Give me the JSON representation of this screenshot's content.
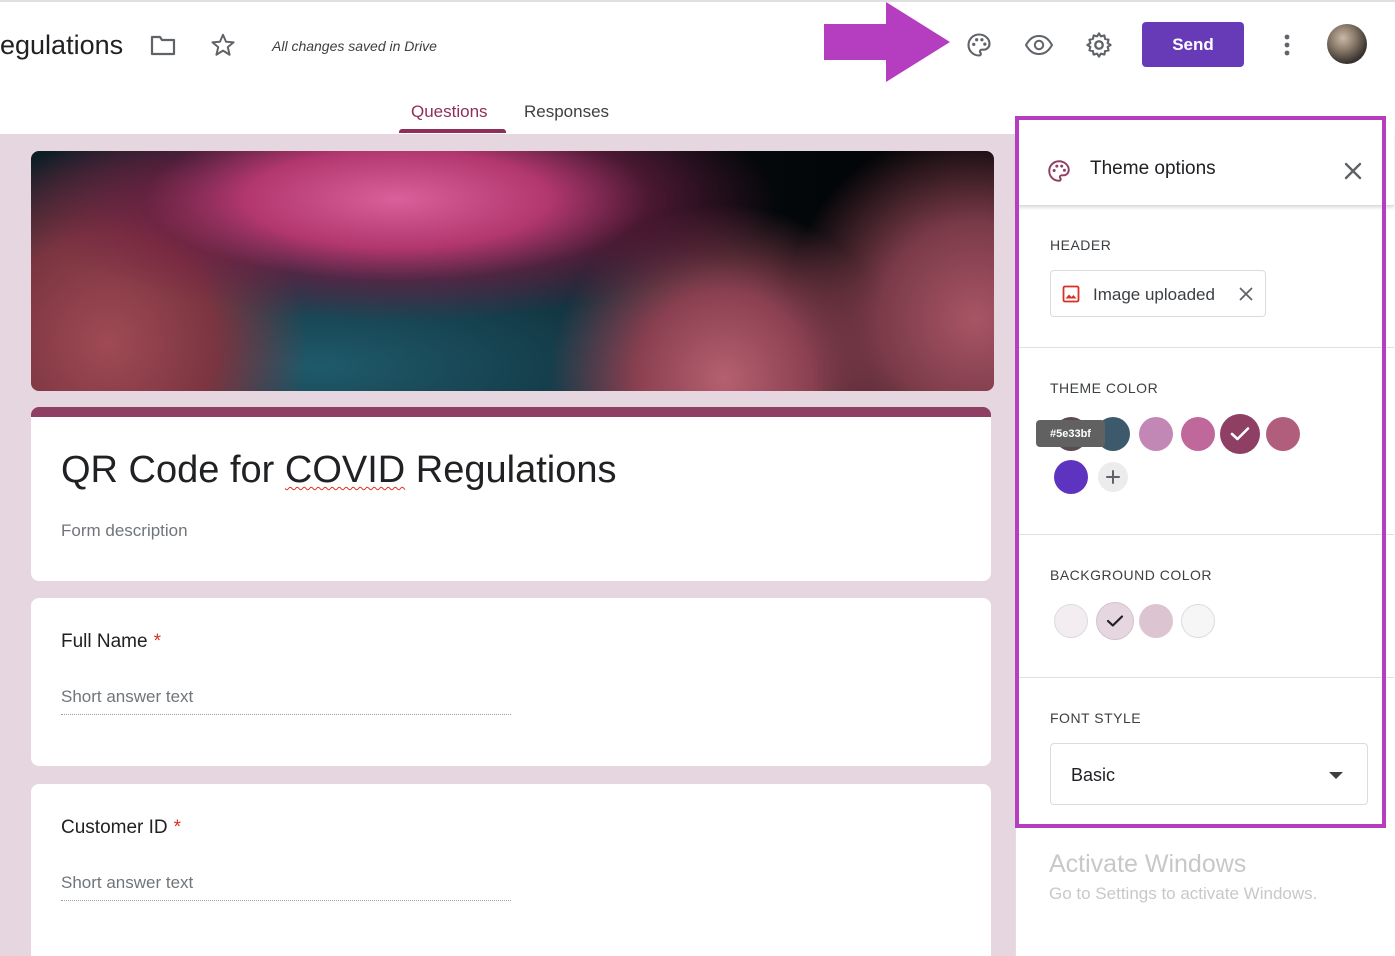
{
  "header": {
    "doc_title": "egulations",
    "saved_status": "All changes saved in Drive",
    "send_label": "Send",
    "icons": [
      "folder-icon",
      "star-icon",
      "palette-icon",
      "eye-icon",
      "gear-icon",
      "more-vert-icon"
    ]
  },
  "tabs": [
    {
      "label": "Questions",
      "active": true
    },
    {
      "label": "Responses",
      "active": false
    }
  ],
  "form": {
    "title_prefix": "QR Code for ",
    "title_word": "COVID",
    "title_suffix": " Regulations",
    "description_placeholder": "Form description",
    "questions": [
      {
        "title": "Full Name",
        "required_mark": "*",
        "answer_placeholder": "Short answer text"
      },
      {
        "title": "Customer ID",
        "required_mark": "*",
        "answer_placeholder": "Short answer text"
      }
    ]
  },
  "theme_panel": {
    "title": "Theme options",
    "header_section_label": "HEADER",
    "header_chip_label": "Image uploaded",
    "theme_color_label": "THEME COLOR",
    "theme_color_tooltip": "#5e33bf",
    "theme_colors": [
      "#5c4a52",
      "#3d5a6c",
      "#c387b5",
      "#c0679c",
      "#8e3f63",
      "#b05e7c",
      "#5e33bf"
    ],
    "theme_color_selected": "#8e3f63",
    "background_color_label": "BACKGROUND COLOR",
    "background_colors": [
      "#f3ecf0",
      "#e6d6df",
      "#dcc4d1",
      "#f6f6f6"
    ],
    "background_color_selected": "#e6d6df",
    "font_style_label": "FONT STYLE",
    "font_style_value": "Basic"
  },
  "watermark": {
    "title": "Activate Windows",
    "subtitle": "Go to Settings to activate Windows."
  },
  "colors": {
    "accent": "#673ab7",
    "theme": "#8e3f63",
    "background": "#e6d6df",
    "annotation": "#b43dc0"
  }
}
